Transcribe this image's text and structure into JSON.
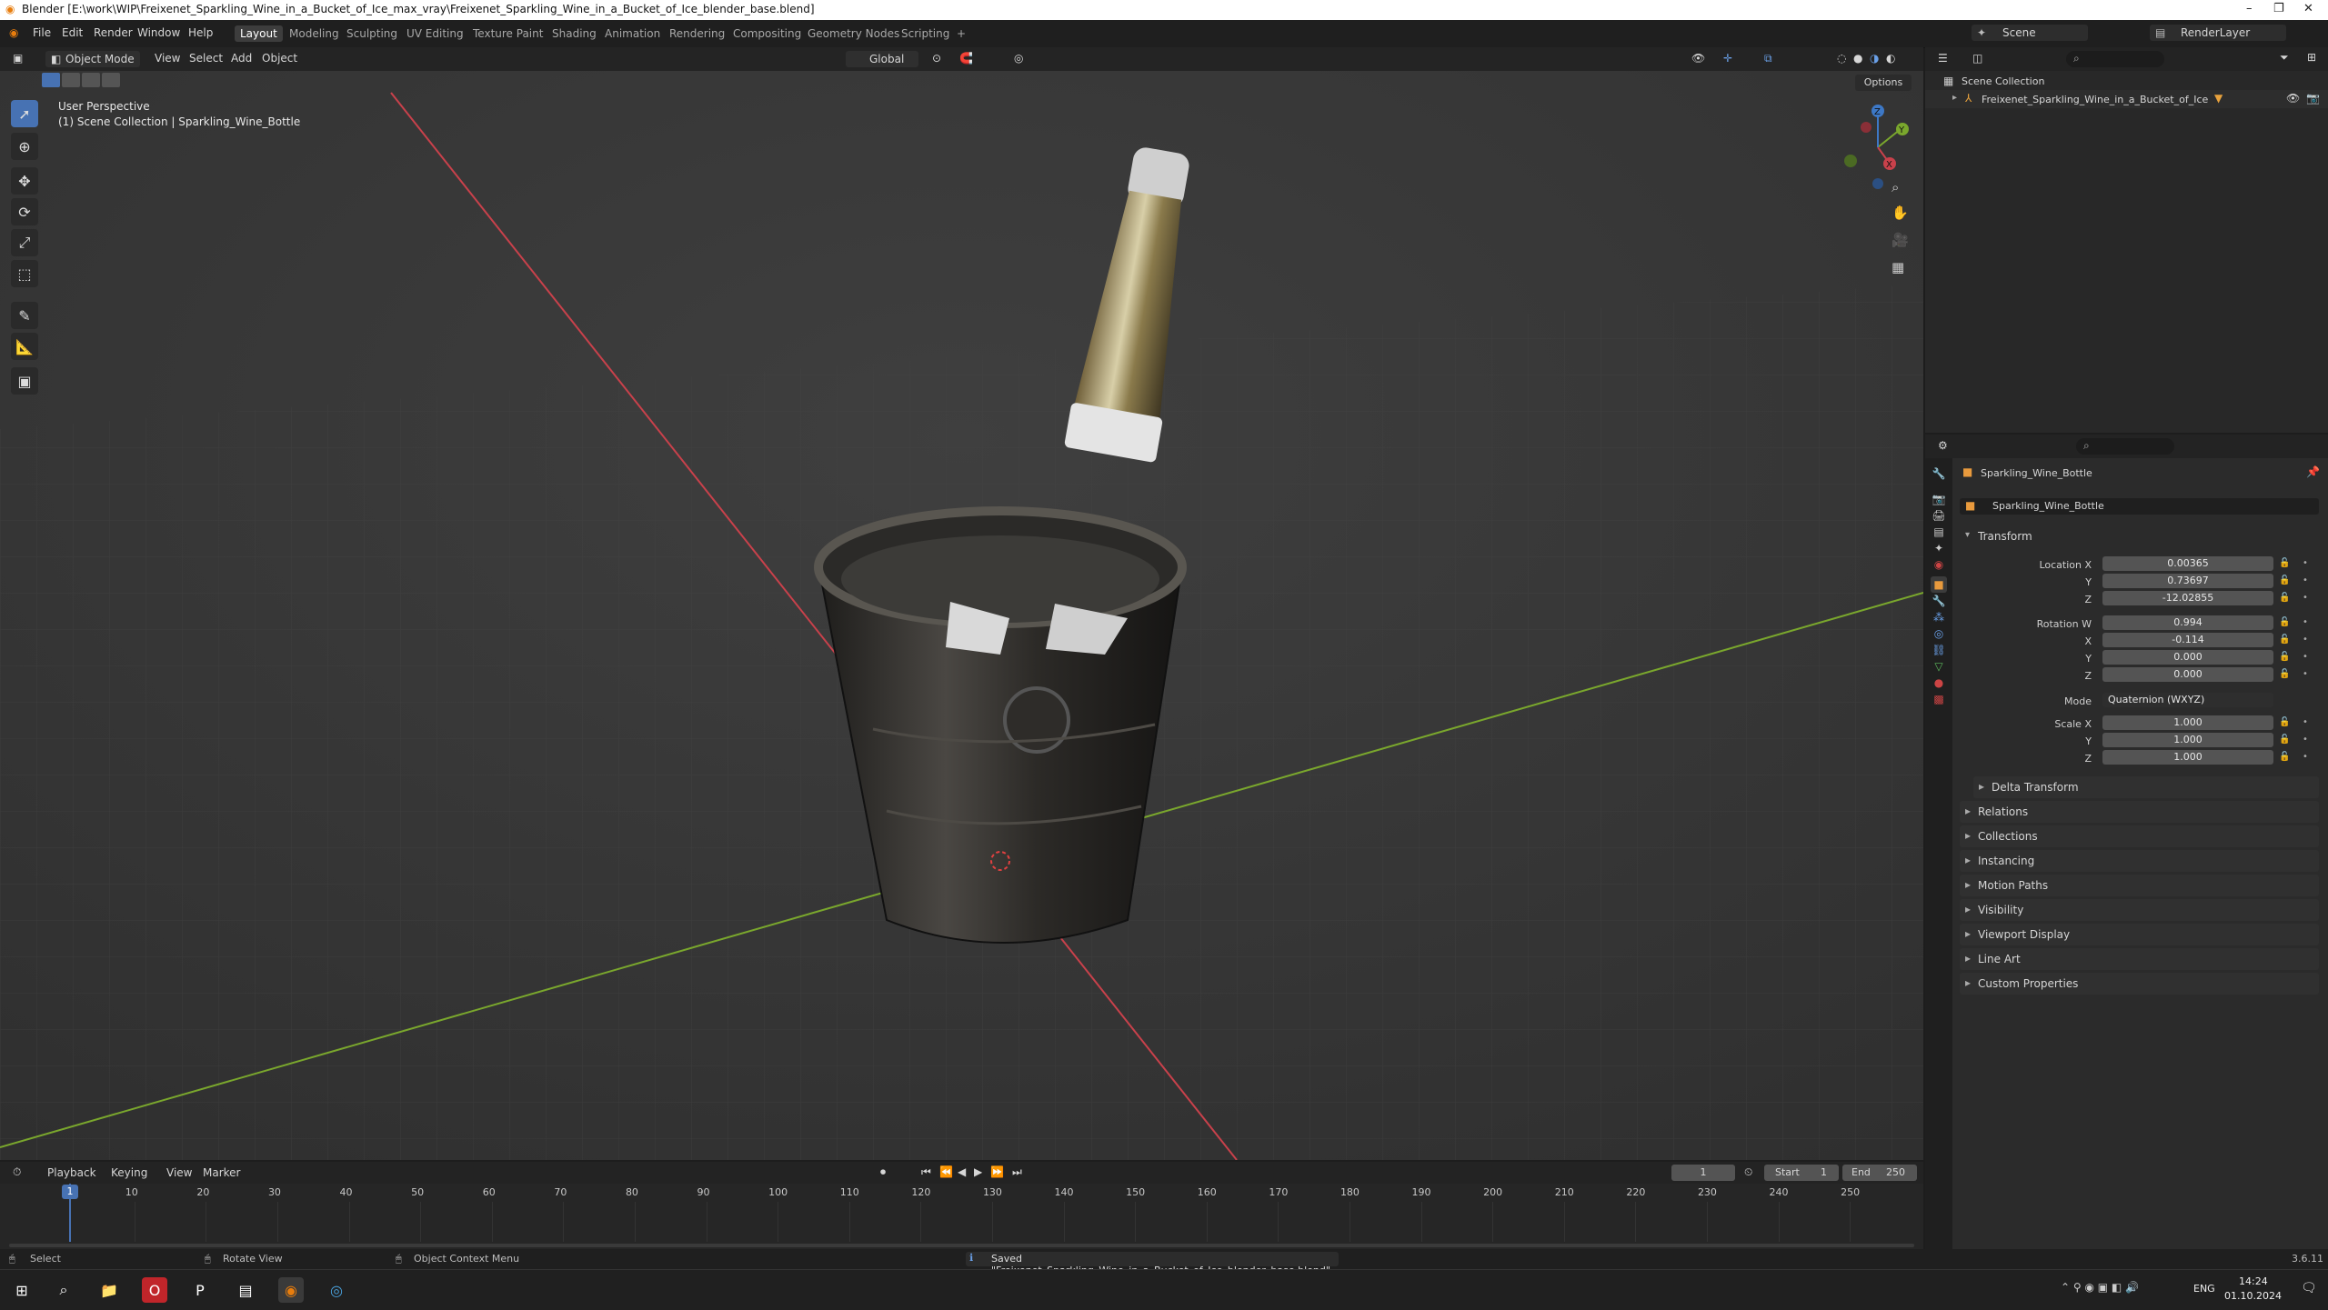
{
  "window": {
    "title": "Blender [E:\\work\\WIP\\Freixenet_Sparkling_Wine_in_a_Bucket_of_Ice_max_vray\\Freixenet_Sparkling_Wine_in_a_Bucket_of_Ice_blender_base.blend]",
    "minimize": "–",
    "maximize": "❐",
    "close": "✕"
  },
  "menu": {
    "items": [
      "File",
      "Edit",
      "Render",
      "Window",
      "Help"
    ]
  },
  "workspaces": {
    "tabs": [
      "Layout",
      "Modeling",
      "Sculpting",
      "UV Editing",
      "Texture Paint",
      "Shading",
      "Animation",
      "Rendering",
      "Compositing",
      "Geometry Nodes",
      "Scripting"
    ],
    "active": "Layout",
    "add": "+"
  },
  "scene": {
    "name": "Scene",
    "render_layer": "RenderLayer"
  },
  "viewport": {
    "mode": "Object Mode",
    "menus": [
      "View",
      "Select",
      "Add",
      "Object"
    ],
    "orientation": "Global",
    "options": "Options",
    "view_label": "User Perspective",
    "collection_label": "(1) Scene Collection | Sparkling_Wine_Bottle",
    "gizmo": {
      "x": "X",
      "y": "Y",
      "z": "Z"
    }
  },
  "outliner": {
    "root": "Scene Collection",
    "items": [
      "Freixenet_Sparkling_Wine_in_a_Bucket_of_Ice"
    ]
  },
  "properties": {
    "object_name": "Sparkling_Wine_Bottle",
    "data_name": "Sparkling_Wine_Bottle",
    "transform_title": "Transform",
    "location": {
      "label": "Location X",
      "x": "0.00365",
      "y": "0.73697",
      "z": "-12.02855"
    },
    "rotation": {
      "label": "Rotation W",
      "w": "0.994",
      "x": "-0.114",
      "y": "0.000",
      "z": "0.000"
    },
    "mode": {
      "label": "Mode",
      "value": "Quaternion (WXYZ)"
    },
    "scale": {
      "label": "Scale X",
      "x": "1.000",
      "y": "1.000",
      "z": "1.000"
    },
    "axis_labels": {
      "y": "Y",
      "z": "Z",
      "x": "X"
    },
    "sections": [
      "Delta Transform",
      "Relations",
      "Collections",
      "Instancing",
      "Motion Paths",
      "Visibility",
      "Viewport Display",
      "Line Art",
      "Custom Properties"
    ]
  },
  "timeline": {
    "menus": [
      "Playback",
      "Keying",
      "View",
      "Marker"
    ],
    "current_frame": "1",
    "start_label": "Start",
    "start": "1",
    "end_label": "End",
    "end": "250",
    "ticks": [
      "1",
      "10",
      "20",
      "30",
      "40",
      "50",
      "60",
      "70",
      "80",
      "90",
      "100",
      "110",
      "120",
      "130",
      "140",
      "150",
      "160",
      "170",
      "180",
      "190",
      "200",
      "210",
      "220",
      "230",
      "240",
      "250"
    ]
  },
  "status": {
    "select": "Select",
    "rotate": "Rotate View",
    "context": "Object Context Menu",
    "message": "Saved \"Freixenet_Sparkling_Wine_in_a_Bucket_of_Ice_blender_base.blend\"",
    "version": "3.6.11"
  },
  "taskbar": {
    "time": "14:24",
    "date": "01.10.2024",
    "lang": "ENG"
  },
  "colors": {
    "accent": "#4772b3",
    "x_axis": "#c8414b",
    "y_axis": "#7aa72d",
    "z_axis": "#3d78c6"
  }
}
